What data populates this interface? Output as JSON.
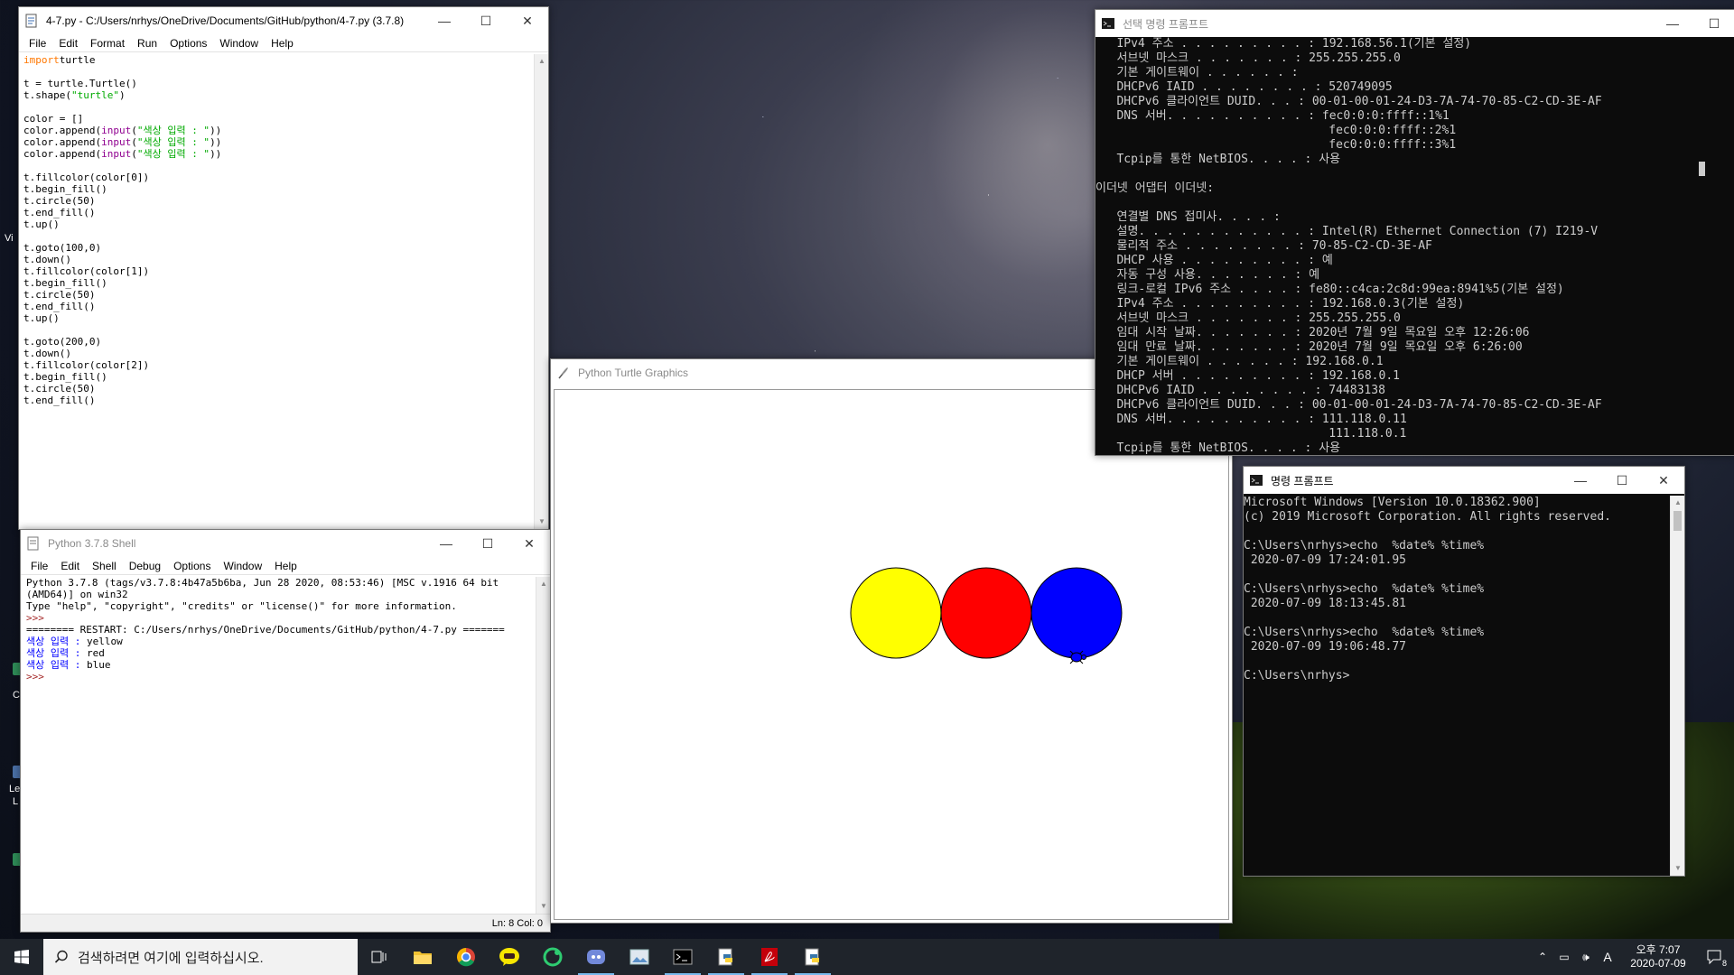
{
  "idle": {
    "title": "4-7.py - C:/Users/nrhys/OneDrive/Documents/GitHub/python/4-7.py (3.7.8)",
    "menus": [
      "File",
      "Edit",
      "Format",
      "Run",
      "Options",
      "Window",
      "Help"
    ],
    "code_lines": [
      [
        [
          "kw",
          "import"
        ],
        [
          "",
          "turtle"
        ]
      ],
      [],
      [
        [
          "",
          "t = turtle.Turtle()"
        ]
      ],
      [
        [
          "",
          "t.shape("
        ],
        [
          "st",
          "\"turtle\""
        ],
        [
          "",
          ")"
        ]
      ],
      [],
      [
        [
          "",
          "color = []"
        ]
      ],
      [
        [
          "",
          "color.append("
        ],
        [
          "bi",
          "input"
        ],
        [
          "",
          "("
        ],
        [
          "st",
          "\"색상 입력 : \""
        ],
        [
          "",
          "))"
        ]
      ],
      [
        [
          "",
          "color.append("
        ],
        [
          "bi",
          "input"
        ],
        [
          "",
          "("
        ],
        [
          "st",
          "\"색상 입력 : \""
        ],
        [
          "",
          "))"
        ]
      ],
      [
        [
          "",
          "color.append("
        ],
        [
          "bi",
          "input"
        ],
        [
          "",
          "("
        ],
        [
          "st",
          "\"색상 입력 : \""
        ],
        [
          "",
          "))"
        ]
      ],
      [],
      [
        [
          "",
          "t.fillcolor(color[0])"
        ]
      ],
      [
        [
          "",
          "t.begin_fill()"
        ]
      ],
      [
        [
          "",
          "t.circle(50)"
        ]
      ],
      [
        [
          "",
          "t.end_fill()"
        ]
      ],
      [
        [
          "",
          "t.up()"
        ]
      ],
      [],
      [
        [
          "",
          "t.goto(100,0)"
        ]
      ],
      [
        [
          "",
          "t.down()"
        ]
      ],
      [
        [
          "",
          "t.fillcolor(color[1])"
        ]
      ],
      [
        [
          "",
          "t.begin_fill()"
        ]
      ],
      [
        [
          "",
          "t.circle(50)"
        ]
      ],
      [
        [
          "",
          "t.end_fill()"
        ]
      ],
      [
        [
          "",
          "t.up()"
        ]
      ],
      [],
      [
        [
          "",
          "t.goto(200,0)"
        ]
      ],
      [
        [
          "",
          "t.down()"
        ]
      ],
      [
        [
          "",
          "t.fillcolor(color[2])"
        ]
      ],
      [
        [
          "",
          "t.begin_fill()"
        ]
      ],
      [
        [
          "",
          "t.circle(50)"
        ]
      ],
      [
        [
          "",
          "t.end_fill()"
        ]
      ]
    ]
  },
  "shell": {
    "title": "Python 3.7.8 Shell",
    "menus": [
      "File",
      "Edit",
      "Shell",
      "Debug",
      "Options",
      "Window",
      "Help"
    ],
    "lines": [
      [
        [
          "",
          "Python 3.7.8 (tags/v3.7.8:4b47a5b6ba, Jun 28 2020, 08:53:46) [MSC v.1916 64 bit"
        ]
      ],
      [
        [
          "",
          "(AMD64)] on win32"
        ]
      ],
      [
        [
          "",
          "Type \"help\", \"copyright\", \"credits\" or \"license()\" for more information."
        ]
      ],
      [
        [
          "pr",
          ">>> "
        ]
      ],
      [
        [
          "",
          "======== RESTART: C:/Users/nrhys/OneDrive/Documents/GitHub/python/4-7.py ======="
        ]
      ],
      [
        [
          "in",
          "색상 입력 : "
        ],
        [
          "",
          "yellow"
        ]
      ],
      [
        [
          "in",
          "색상 입력 : "
        ],
        [
          "",
          "red"
        ]
      ],
      [
        [
          "in",
          "색상 입력 : "
        ],
        [
          "",
          "blue"
        ]
      ],
      [
        [
          "pr",
          ">>> "
        ]
      ]
    ],
    "status": "Ln: 8   Col: 0"
  },
  "turtle": {
    "title": "Python Turtle Graphics",
    "circles": [
      {
        "fill": "#ffff00"
      },
      {
        "fill": "#ff0000"
      },
      {
        "fill": "#0000ff"
      }
    ]
  },
  "cmd_admin": {
    "title": "선택 명령 프롬프트",
    "lines": [
      "   IPv4 주소 . . . . . . . . . : 192.168.56.1(기본 설정)",
      "   서브넷 마스크 . . . . . . . : 255.255.255.0",
      "   기본 게이트웨이 . . . . . . :",
      "   DHCPv6 IAID . . . . . . . . : 520749095",
      "   DHCPv6 클라이언트 DUID. . . : 00-01-00-01-24-D3-7A-74-70-85-C2-CD-3E-AF",
      "   DNS 서버. . . . . . . . . . : fec0:0:0:ffff::1%1",
      "                                 fec0:0:0:ffff::2%1",
      "                                 fec0:0:0:ffff::3%1",
      "   Tcpip를 통한 NetBIOS. . . . : 사용",
      "",
      "이더넷 어댑터 이더넷:",
      "",
      "   연결별 DNS 접미사. . . . :",
      "   설명. . . . . . . . . . . . : Intel(R) Ethernet Connection (7) I219-V",
      "   물리적 주소 . . . . . . . . : 70-85-C2-CD-3E-AF",
      "   DHCP 사용 . . . . . . . . . : 예",
      "   자동 구성 사용. . . . . . . : 예",
      "   링크-로컬 IPv6 주소 . . . . : fe80::c4ca:2c8d:99ea:8941%5(기본 설정)",
      "   IPv4 주소 . . . . . . . . . : 192.168.0.3(기본 설정)",
      "   서브넷 마스크 . . . . . . . : 255.255.255.0",
      "   임대 시작 날짜. . . . . . . : 2020년 7월 9일 목요일 오후 12:26:06",
      "   임대 만료 날짜. . . . . . . : 2020년 7월 9일 목요일 오후 6:26:00",
      "   기본 게이트웨이 . . . . . . : 192.168.0.1",
      "   DHCP 서버 . . . . . . . . . : 192.168.0.1",
      "   DHCPv6 IAID . . . . . . . . : 74483138",
      "   DHCPv6 클라이언트 DUID. . . : 00-01-00-01-24-D3-7A-74-70-85-C2-CD-3E-AF",
      "   DNS 서버. . . . . . . . . . : 111.118.0.11",
      "                                 111.118.0.1",
      "   Tcpip를 통한 NetBIOS. . . . : 사용"
    ]
  },
  "cmd": {
    "title": "명령 프롬프트",
    "lines": [
      "Microsoft Windows [Version 10.0.18362.900]",
      "(c) 2019 Microsoft Corporation. All rights reserved.",
      "",
      "C:\\Users\\nrhys>echo  %date% %time%",
      " 2020-07-09 17:24:01.95",
      "",
      "C:\\Users\\nrhys>echo  %date% %time%",
      " 2020-07-09 18:13:45.81",
      "",
      "C:\\Users\\nrhys>echo  %date% %time%",
      " 2020-07-09 19:06:48.77",
      "",
      "C:\\Users\\nrhys>"
    ]
  },
  "window_controls": {
    "minimize": "—",
    "maximize": "☐",
    "close": "✕"
  },
  "taskbar": {
    "search_placeholder": "검색하려면 여기에 입력하십시오.",
    "time": "오후 7:07",
    "date": "2020-07-09",
    "ime": "A",
    "notification_count": "8"
  },
  "desktop_fragments": {
    "vi": "Vi",
    "c": "C",
    "le": "Le",
    "l": "L"
  }
}
